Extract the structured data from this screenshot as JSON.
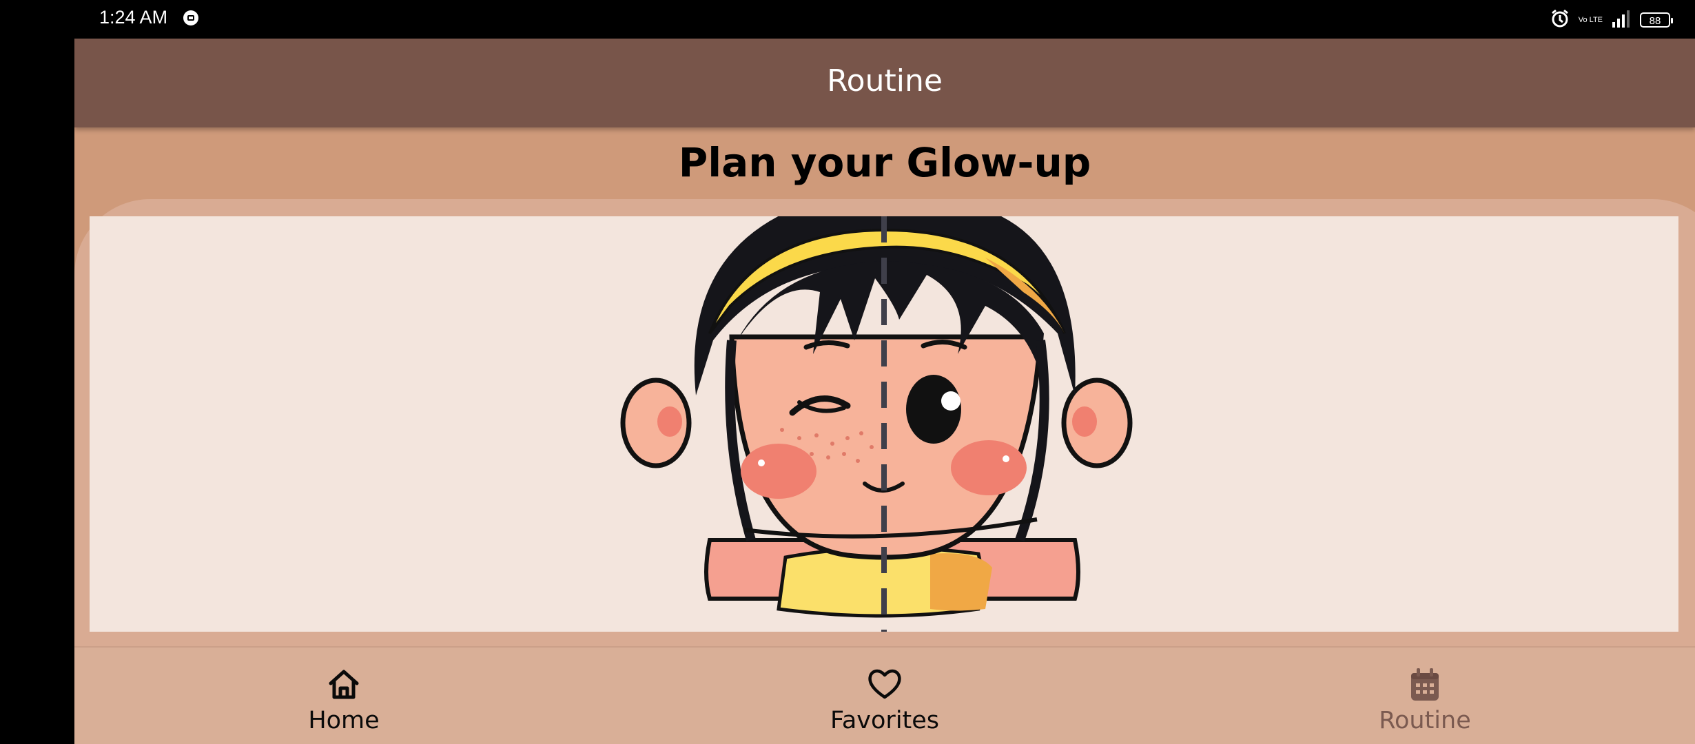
{
  "status_bar": {
    "time": "1:24 AM",
    "network": "Vo LTE",
    "battery": "88"
  },
  "app_bar": {
    "title": "Routine"
  },
  "page": {
    "heading": "Plan your Glow-up"
  },
  "bottom_nav": {
    "items": [
      {
        "label": "Home",
        "icon": "home-icon"
      },
      {
        "label": "Favorites",
        "icon": "heart-icon"
      },
      {
        "label": "Routine",
        "icon": "calendar-icon"
      }
    ]
  },
  "colors": {
    "app_bar": "#78554a",
    "background": "#cf9a7a",
    "card": "#d9ab93",
    "image_bg": "#f3e5dd",
    "nav_bg": "#d9af97",
    "nav_inactive": "#7b5a50"
  }
}
